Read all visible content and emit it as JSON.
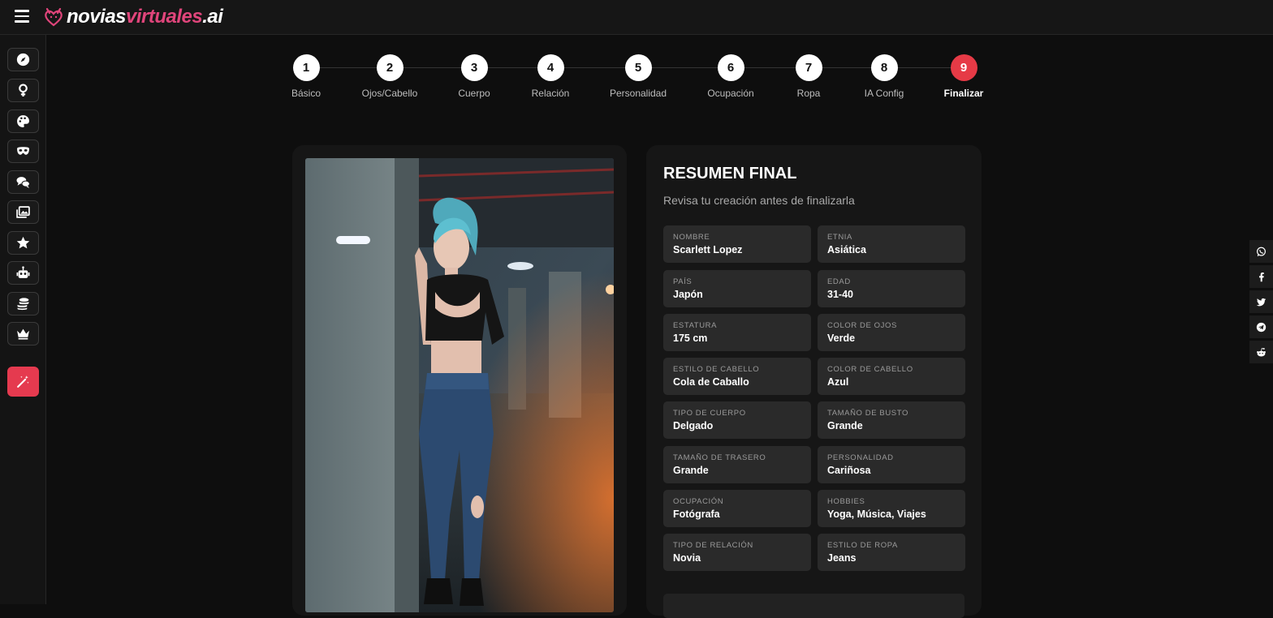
{
  "brand": {
    "part1": "novias",
    "part2": "virtuales",
    "part3": ".ai"
  },
  "sidebar": {
    "items": [
      {
        "icon": "compass-icon"
      },
      {
        "icon": "venus-icon"
      },
      {
        "icon": "palette-icon"
      },
      {
        "icon": "mask-icon"
      },
      {
        "icon": "chat-icon"
      },
      {
        "icon": "gallery-icon"
      },
      {
        "icon": "star-icon"
      },
      {
        "icon": "robot-icon"
      },
      {
        "icon": "coins-icon"
      },
      {
        "icon": "crown-icon"
      },
      {
        "icon": "magic-wand-icon"
      }
    ]
  },
  "steps": [
    {
      "number": "1",
      "label": "Básico"
    },
    {
      "number": "2",
      "label": "Ojos/Cabello"
    },
    {
      "number": "3",
      "label": "Cuerpo"
    },
    {
      "number": "4",
      "label": "Relación"
    },
    {
      "number": "5",
      "label": "Personalidad"
    },
    {
      "number": "6",
      "label": "Ocupación"
    },
    {
      "number": "7",
      "label": "Ropa"
    },
    {
      "number": "8",
      "label": "IA Config"
    },
    {
      "number": "9",
      "label": "Finalizar"
    }
  ],
  "active_step": 9,
  "summary": {
    "title": "RESUMEN FINAL",
    "subtitle": "Revisa tu creación antes de finalizarla",
    "fields": [
      {
        "label": "NOMBRE",
        "value": "Scarlett Lopez"
      },
      {
        "label": "ETNIA",
        "value": "Asiática"
      },
      {
        "label": "PAÍS",
        "value": "Japón"
      },
      {
        "label": "EDAD",
        "value": "31-40"
      },
      {
        "label": "ESTATURA",
        "value": "175 cm"
      },
      {
        "label": "COLOR DE OJOS",
        "value": "Verde"
      },
      {
        "label": "ESTILO DE CABELLO",
        "value": "Cola de Caballo"
      },
      {
        "label": "COLOR DE CABELLO",
        "value": "Azul"
      },
      {
        "label": "TIPO DE CUERPO",
        "value": "Delgado"
      },
      {
        "label": "TAMAÑO DE BUSTO",
        "value": "Grande"
      },
      {
        "label": "TAMAÑO DE TRASERO",
        "value": "Grande"
      },
      {
        "label": "PERSONALIDAD",
        "value": "Cariñosa"
      },
      {
        "label": "OCUPACIÓN",
        "value": "Fotógrafa"
      },
      {
        "label": "HOBBIES",
        "value": "Yoga, Música, Viajes"
      },
      {
        "label": "TIPO DE RELACIÓN",
        "value": "Novia"
      },
      {
        "label": "ESTILO DE ROPA",
        "value": "Jeans"
      }
    ]
  },
  "share": [
    {
      "icon": "whatsapp-icon"
    },
    {
      "icon": "facebook-icon"
    },
    {
      "icon": "twitter-icon"
    },
    {
      "icon": "telegram-icon"
    },
    {
      "icon": "reddit-icon"
    }
  ],
  "colors": {
    "accent": "#e63a46",
    "brand_pink": "#e0457b"
  }
}
